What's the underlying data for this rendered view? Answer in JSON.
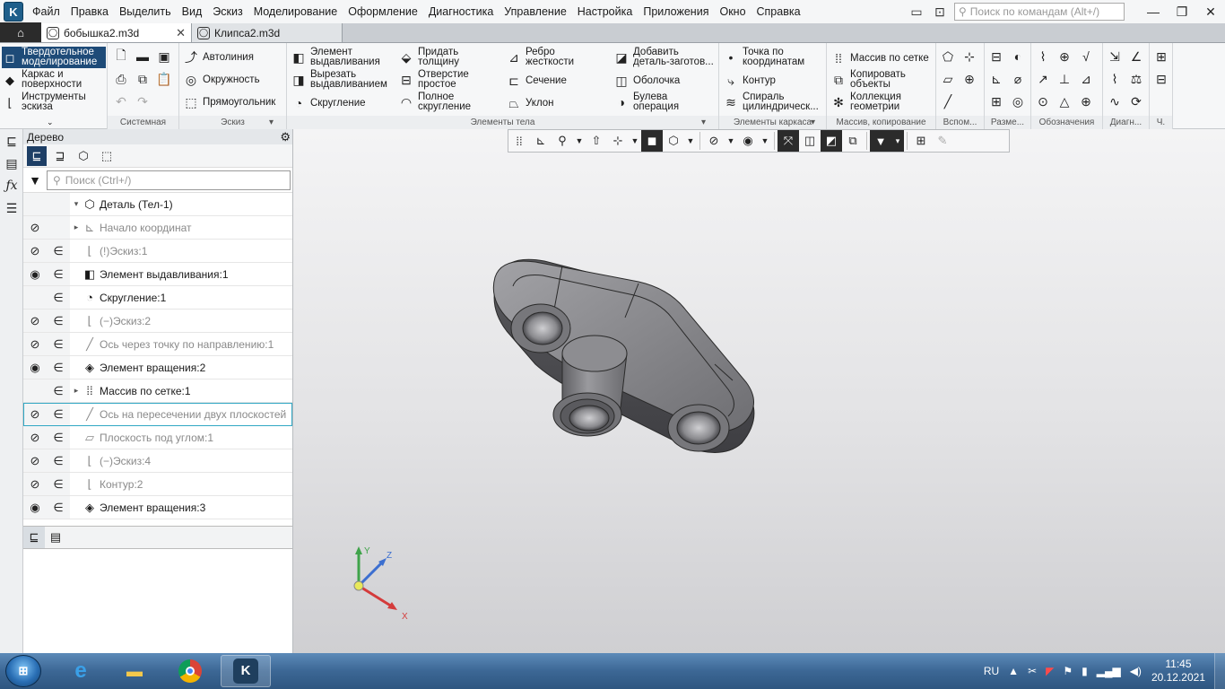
{
  "menu": {
    "items": [
      "Файл",
      "Правка",
      "Выделить",
      "Вид",
      "Эскиз",
      "Моделирование",
      "Оформление",
      "Диагностика",
      "Управление",
      "Настройка",
      "Приложения",
      "Окно",
      "Справка"
    ],
    "search_placeholder": "Поиск по командам (Alt+/)"
  },
  "tabs": {
    "docs": [
      {
        "title": "бобышка2.m3d",
        "active": true
      },
      {
        "title": "Клипса2.m3d",
        "active": false
      }
    ]
  },
  "ribbon": {
    "modes": [
      "Твердотельное\nмоделирование",
      "Каркас и\nповерхности",
      "Инструменты\nэскиза"
    ],
    "groups": {
      "system": "Системная",
      "sketch": "Эскиз",
      "body": "Элементы тела",
      "frame": "Элементы каркаса",
      "pattern": "Массив, копирование",
      "aux": "Вспом...",
      "dims": "Разме...",
      "notation": "Обозначения",
      "diag": "Диагн...",
      "ch": "Ч."
    },
    "sketch_buttons": [
      "Автолиния",
      "Окружность",
      "Прямоугольник"
    ],
    "body_buttons": [
      "Элемент\nвыдавливания",
      "Вырезать\nвыдавливанием",
      "Скругление",
      "Придать\nтолщину",
      "Отверстие\nпростое",
      "Полное\nскругление",
      "Ребро\nжесткости",
      "Сечение",
      "Уклон",
      "Добавить\nдеталь-заготов...",
      "Оболочка",
      "Булева\nоперация"
    ],
    "frame_buttons": [
      "Точка по\nкоординатам",
      "Контур",
      "Спираль\nцилиндрическ..."
    ],
    "pattern_buttons": [
      "Массив по сетке",
      "Копировать\nобъекты",
      "Коллекция\nгеометрии"
    ]
  },
  "tree": {
    "title": "Дерево",
    "search_placeholder": "Поиск (Ctrl+/)",
    "rows": [
      {
        "label": "Деталь (Тел-1)",
        "dim": false,
        "eye": "",
        "link": "",
        "exp": "▾",
        "icon": "⬡"
      },
      {
        "label": "Начало координат",
        "dim": true,
        "eye": "hidden",
        "link": "",
        "exp": "▸",
        "icon": "⊾"
      },
      {
        "label": "(!)Эскиз:1",
        "dim": true,
        "eye": "hidden",
        "link": "∈",
        "exp": "",
        "icon": "⌊"
      },
      {
        "label": "Элемент выдавливания:1",
        "dim": false,
        "eye": "visible",
        "link": "∈",
        "exp": "",
        "icon": "◧"
      },
      {
        "label": "Скругление:1",
        "dim": false,
        "eye": "",
        "link": "∈",
        "exp": "",
        "icon": "◔"
      },
      {
        "label": "(−)Эскиз:2",
        "dim": true,
        "eye": "hidden",
        "link": "∈",
        "exp": "",
        "icon": "⌊"
      },
      {
        "label": "Ось через точку по направлению:1",
        "dim": true,
        "eye": "hidden",
        "link": "∈",
        "exp": "",
        "icon": "╱"
      },
      {
        "label": "Элемент вращения:2",
        "dim": false,
        "eye": "visible",
        "link": "∈",
        "exp": "",
        "icon": "◈"
      },
      {
        "label": "Массив по сетке:1",
        "dim": false,
        "eye": "",
        "link": "∈",
        "exp": "▸",
        "icon": "⁞⁞"
      },
      {
        "label": "Ось на пересечении двух плоскостей",
        "dim": true,
        "eye": "hidden",
        "link": "∈",
        "exp": "",
        "icon": "╱",
        "selected": true
      },
      {
        "label": "Плоскость под углом:1",
        "dim": true,
        "eye": "hidden",
        "link": "∈",
        "exp": "",
        "icon": "▱"
      },
      {
        "label": "(−)Эскиз:4",
        "dim": true,
        "eye": "hidden",
        "link": "∈",
        "exp": "",
        "icon": "⌊"
      },
      {
        "label": "Контур:2",
        "dim": true,
        "eye": "hidden",
        "link": "∈",
        "exp": "",
        "icon": "⌊"
      },
      {
        "label": "Элемент вращения:3",
        "dim": false,
        "eye": "visible",
        "link": "∈",
        "exp": "",
        "icon": "◈"
      }
    ]
  },
  "viewport": {
    "axis_labels": {
      "x": "X",
      "y": "Y",
      "z": "Z"
    },
    "colors": {
      "model": "#7d7d80",
      "x_axis": "#d43b3b",
      "y_axis": "#3fa34a",
      "z_axis": "#3c6fd0"
    }
  },
  "taskbar": {
    "lang": "RU",
    "time": "11:45",
    "date": "20.12.2021"
  }
}
